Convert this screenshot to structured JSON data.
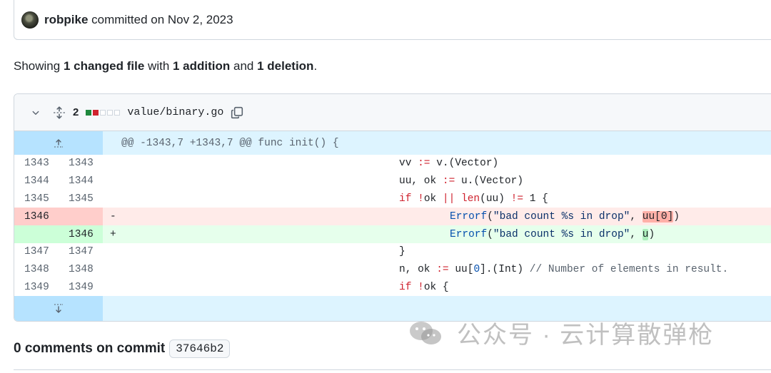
{
  "commit": {
    "author": "robpike",
    "text": "committed on Nov 2, 2023"
  },
  "summary": {
    "prefix": "Showing ",
    "files": "1 changed file",
    "mid1": " with ",
    "additions": "1 addition",
    "mid2": " and ",
    "deletions": "1 deletion",
    "suffix": "."
  },
  "file": {
    "changes": "2",
    "name": "value/binary.go"
  },
  "hunk": "@@ -1343,7 +1343,7 @@ func init() {",
  "lines": [
    {
      "old": "1343",
      "new": "1343"
    },
    {
      "old": "1344",
      "new": "1344"
    },
    {
      "old": "1345",
      "new": "1345"
    },
    {
      "old": "1346",
      "new": "",
      "sign": "-"
    },
    {
      "old": "",
      "new": "1346",
      "sign": "+"
    },
    {
      "old": "1347",
      "new": "1347"
    },
    {
      "old": "1348",
      "new": "1348"
    },
    {
      "old": "1349",
      "new": "1349"
    }
  ],
  "code": {
    "l0": {
      "a": "vv ",
      "b": ":=",
      "c": " v.(Vector)"
    },
    "l1": {
      "a": "uu, ok ",
      "b": ":=",
      "c": " u.(Vector)"
    },
    "l2": {
      "a": "if",
      "b": " ",
      "c": "!",
      "d": "ok ",
      "e": "||",
      "f": " ",
      "g": "len",
      "h": "(uu) ",
      "i": "!=",
      "j": " 1 {"
    },
    "l3": {
      "a": "Errorf",
      "b": "(",
      "c": "\"bad count %s in drop\"",
      "d": ", ",
      "e": "uu[0]",
      "f": ")"
    },
    "l4": {
      "a": "Errorf",
      "b": "(",
      "c": "\"bad count %s in drop\"",
      "d": ", ",
      "e": "u",
      "f": ")"
    },
    "l5": {
      "a": "}"
    },
    "l6": {
      "a": "n, ok ",
      "b": ":=",
      "c": " uu[",
      "d": "0",
      "e": "].(Int) ",
      "f": "// Number of elements in result."
    },
    "l7": {
      "a": "if",
      "b": " ",
      "c": "!",
      "d": "ok {"
    }
  },
  "comments": {
    "label": "0 comments on commit",
    "sha": "37646b2"
  },
  "watermark": "公众号 · 云计算散弹枪",
  "colors": {
    "added": "#1f883d",
    "deleted": "#cf222e",
    "hunk_bg": "#ddf4ff"
  }
}
